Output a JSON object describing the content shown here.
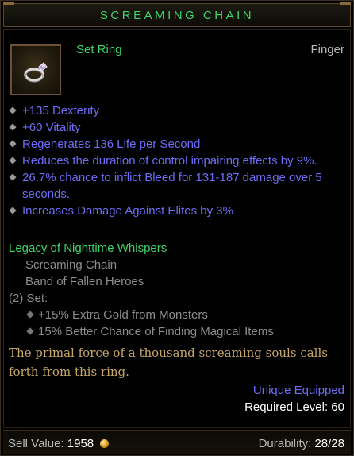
{
  "item": {
    "name": "SCREAMING CHAIN",
    "type": "Set Ring",
    "slot": "Finger",
    "icon": "ring-icon"
  },
  "affixes": [
    "+135 Dexterity",
    "+60 Vitality",
    "Regenerates 136 Life per Second",
    "Reduces the duration of control impairing effects by 9%.",
    "26.7% chance to inflict Bleed for 131-187 damage over 5 seconds.",
    "Increases Damage Against Elites by 3%"
  ],
  "set": {
    "name": "Legacy of Nighttime Whispers",
    "pieces": [
      "Screaming Chain",
      "Band of Fallen Heroes"
    ],
    "bonus_count": "(2) Set:",
    "bonuses": [
      "+15% Extra Gold from Monsters",
      "15% Better Chance of Finding Magical Items"
    ]
  },
  "flavor": "The primal force of a thousand screaming souls calls forth from this ring.",
  "unique_equipped": "Unique Equipped",
  "required_level": "Required Level: 60",
  "footer": {
    "sell_label": "Sell Value:",
    "sell_value": "1958",
    "durability_label": "Durability:",
    "durability_value": "28/28"
  },
  "colors": {
    "set_green": "#3fd36b",
    "magic_blue": "#6f6cf6",
    "gray": "#8c8c8c",
    "flavor_gold": "#c7a767"
  }
}
